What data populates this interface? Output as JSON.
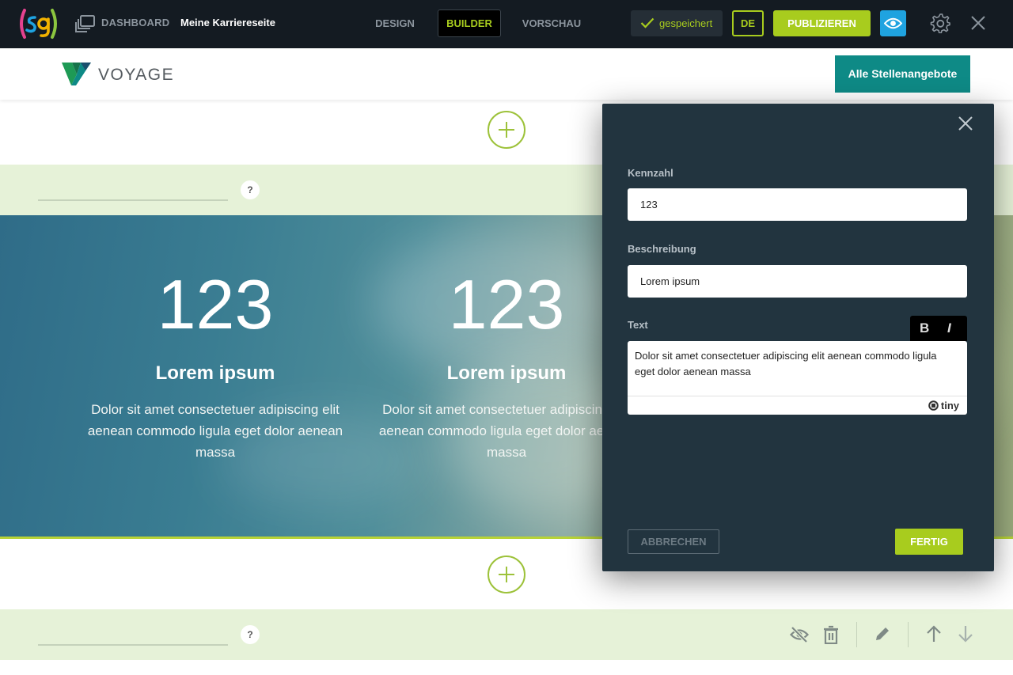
{
  "topbar": {
    "dashboard_label": "DASHBOARD",
    "site_title": "Meine Karriereseite",
    "tabs": [
      {
        "label": "DESIGN"
      },
      {
        "label": "BUILDER"
      },
      {
        "label": "VORSCHAU"
      }
    ],
    "saved_label": "gespeichert",
    "language": "DE",
    "publish_label": "PUBLIZIEREN",
    "accent_color": "#a8cc1e",
    "icons": [
      "sg-logo",
      "dashboard-icon",
      "check-icon",
      "eye-icon",
      "gear-icon",
      "close-icon"
    ]
  },
  "site_header": {
    "brand_name": "VOYAGE",
    "jobs_button": "Alle Stellenangebote",
    "brand_color": "#0e8a86"
  },
  "section_bar": {
    "help": "?",
    "icons": [
      "visibility-off-icon",
      "trash-icon",
      "pencil-icon",
      "arrow-up-icon",
      "arrow-down-icon"
    ]
  },
  "stats": [
    {
      "number": "123",
      "title": "Lorem ipsum",
      "text": "Dolor sit amet consectetuer adipiscing elit aenean commodo ligula eget dolor aenean massa"
    },
    {
      "number": "123",
      "title": "Lorem ipsum",
      "text": "Dolor sit amet consectetuer adipiscing elit aenean commodo ligula eget dolor aenean massa"
    }
  ],
  "modal": {
    "kennzahl_label": "Kennzahl",
    "kennzahl_value": "123",
    "beschreibung_label": "Beschreibung",
    "beschreibung_value": "Lorem ipsum",
    "text_label": "Text",
    "bold": "B",
    "italic": "I",
    "text_value": "Dolor sit amet consectetuer adipiscing elit aenean commodo ligula eget dolor aenean massa",
    "editor_brand": "tiny",
    "cancel_label": "ABBRECHEN",
    "done_label": "FERTIG"
  }
}
